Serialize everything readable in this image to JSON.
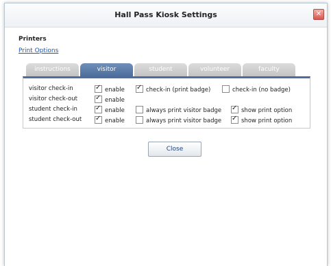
{
  "window": {
    "title": "Hall Pass Kiosk Settings",
    "close_glyph": "✕"
  },
  "printers": {
    "heading": "Printers",
    "link": "Print Options"
  },
  "tabs": [
    {
      "label": "instructions",
      "active": false
    },
    {
      "label": "visitor",
      "active": true
    },
    {
      "label": "student",
      "active": false
    },
    {
      "label": "volunteer",
      "active": false
    },
    {
      "label": "faculty",
      "active": false
    }
  ],
  "rows": [
    {
      "label": "visitor check-in",
      "enable": {
        "label": "enable",
        "checked": true
      },
      "opt1": {
        "label": "check-in (print badge)",
        "checked": true
      },
      "opt2": {
        "label": "check-in (no badge)",
        "checked": false
      }
    },
    {
      "label": "visitor check-out",
      "enable": {
        "label": "enable",
        "checked": true
      }
    },
    {
      "label": "student check-in",
      "enable": {
        "label": "enable",
        "checked": true
      },
      "opt1": {
        "label": "always print visitor badge",
        "checked": false
      },
      "opt2": {
        "label": "show print option",
        "checked": true
      }
    },
    {
      "label": "student check-out",
      "enable": {
        "label": "enable",
        "checked": true
      },
      "opt1": {
        "label": "always print visitor badge",
        "checked": false
      },
      "opt2": {
        "label": "show print option",
        "checked": true
      }
    }
  ],
  "buttons": {
    "close": "Close"
  },
  "colors": {
    "tab_active": "#4d6e9c",
    "tab_inactive": "#c8c8c8",
    "link": "#1f57b0"
  }
}
